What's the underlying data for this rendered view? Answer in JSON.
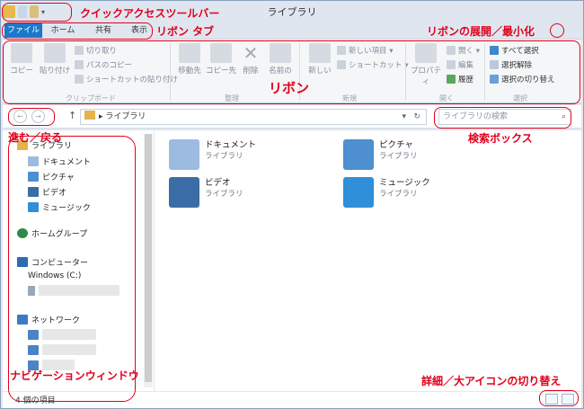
{
  "window": {
    "title": "ライブラリ"
  },
  "tabs": [
    "ファイル",
    "ホーム",
    "共有",
    "表示"
  ],
  "ribbon": {
    "clipboard": {
      "copy": "コピー",
      "paste": "貼り付け",
      "cut": "切り取り",
      "copy_path": "パスのコピー",
      "paste_shortcut": "ショートカットの貼り付け",
      "group": "クリップボード"
    },
    "organize": {
      "move_to": "移動先",
      "copy_to": "コピー先",
      "delete": "削除",
      "rename": "名前の",
      "group": "整理"
    },
    "new": {
      "new_folder": "新しい",
      "new_item": "新しい項目 ▾",
      "shortcut": "ショートカット ▾",
      "group": "新規"
    },
    "open": {
      "properties": "プロパティ",
      "open": "開く ▾",
      "edit": "編集",
      "history": "履歴",
      "group": "開く"
    },
    "select": {
      "select_all": "すべて選択",
      "select_none": "選択解除",
      "invert": "選択の切り替え",
      "group": "選択"
    }
  },
  "address": {
    "path": "ライブラリ",
    "search_placeholder": "ライブラリの検索"
  },
  "nav": {
    "libraries": "ライブラリ",
    "documents": "ドキュメント",
    "pictures": "ピクチャ",
    "videos": "ビデオ",
    "music": "ミュージック",
    "homegroup": "ホームグループ",
    "computer": "コンピューター",
    "drive_c": "Windows (C:)",
    "network": "ネットワーク"
  },
  "content": [
    {
      "name": "ドキュメント",
      "type": "ライブラリ",
      "icon": "documents-icon",
      "color": "#7fa6cf"
    },
    {
      "name": "ピクチャ",
      "type": "ライブラリ",
      "icon": "pictures-icon",
      "color": "#4d8fd1"
    },
    {
      "name": "ビデオ",
      "type": "ライブラリ",
      "icon": "videos-icon",
      "color": "#3a6da6"
    },
    {
      "name": "ミュージック",
      "type": "ライブラリ",
      "icon": "music-icon",
      "color": "#2f8fd8"
    }
  ],
  "status": {
    "count": "4 個の項目"
  },
  "annotations": {
    "qat": "クイックアクセスツールバー",
    "ribbon_tabs": "リボン タブ",
    "ribbon_toggle": "リボンの展開／最小化",
    "ribbon": "リボン",
    "nav_buttons": "進む／戻る",
    "search_box": "検索ボックス",
    "nav_pane": "ナビゲーションウィンドウ",
    "view_toggle": "詳細／大アイコンの切り替え"
  },
  "colors": {
    "accent": "#1979ca",
    "annotation": "#e0001c"
  }
}
